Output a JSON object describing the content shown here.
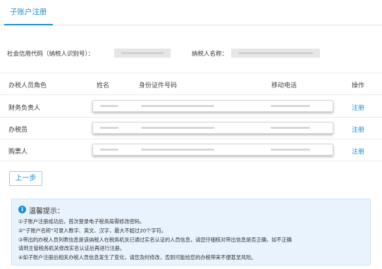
{
  "tab": {
    "label": "子账户注册"
  },
  "info": {
    "credit_code_label": "社会信用代码（纳税人识别号）：",
    "taxpayer_name_label": "纳税人名称："
  },
  "table": {
    "headers": [
      "办税人员角色",
      "姓名",
      "身份证件号码",
      "移动电话",
      "操作"
    ],
    "rows": [
      {
        "role": "财务负责人",
        "action": "注册"
      },
      {
        "role": "办税员",
        "action": "注册"
      },
      {
        "role": "购票人",
        "action": "注册"
      }
    ]
  },
  "back_button": {
    "label": "上一步"
  },
  "tips": {
    "icon": "info-icon",
    "title": "温馨提示：",
    "lines": [
      "①子账户注册成功后，首次登录电子税务局需修改密码。",
      "②“子账户名称”可录入数字、英文、汉字，最大不超过20个字符。",
      "③带出的办税人员列表信息是该纳税人在税务机关已通过实名认证的人员信息，请您仔细核对带出信息是否正确，如不正确",
      "请到主管税务机关修改实名认证后再进行注册。",
      "④如子账户注册后相关办税人员信息发生了变化，请您及时修改，否则可能给您的办税带来不便甚至风险。"
    ]
  },
  "colors": {
    "accent": "#1a8ed8",
    "tips_bg": "#e9f3fd"
  }
}
